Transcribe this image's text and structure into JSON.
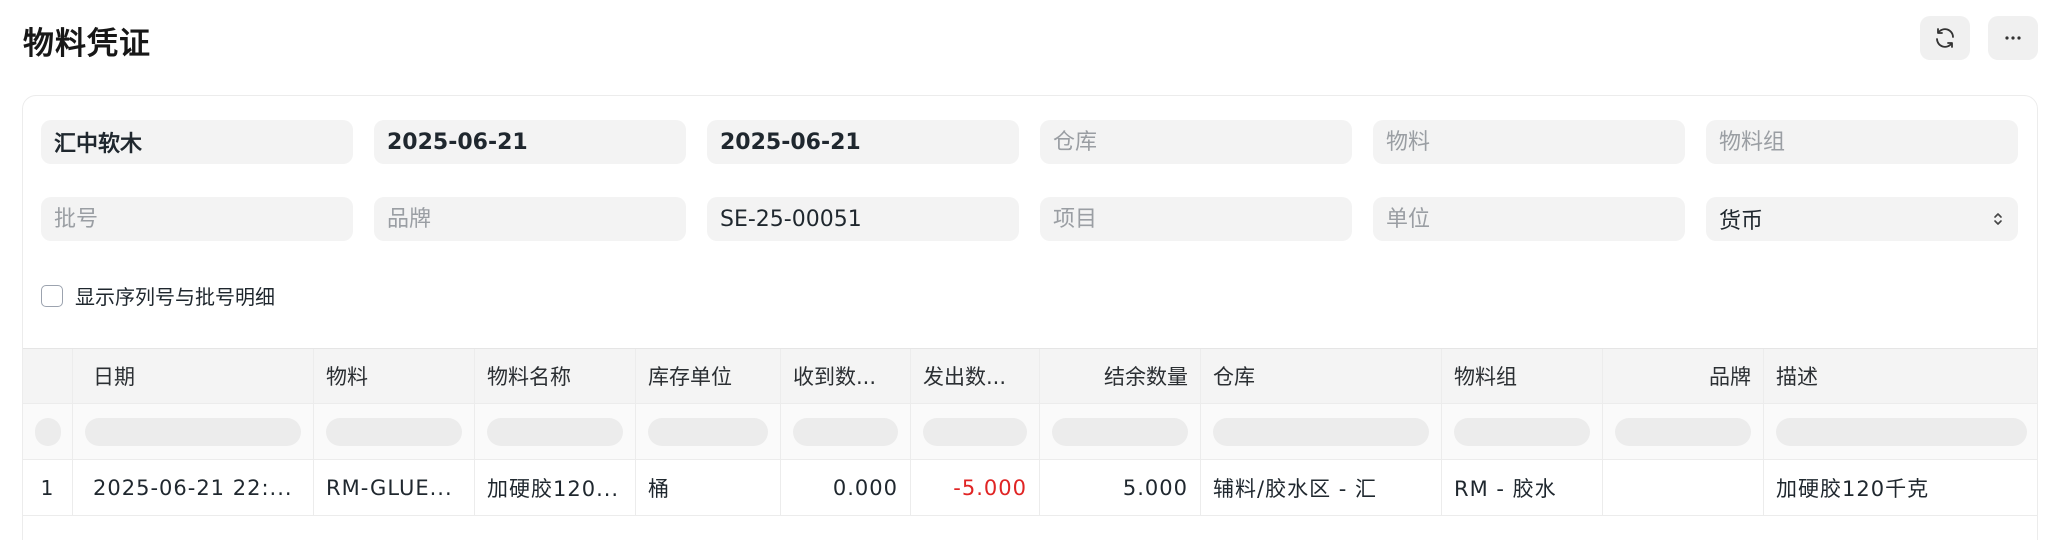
{
  "page": {
    "title": "物料凭证"
  },
  "filters": {
    "company": {
      "value": "汇中软木",
      "placeholder": ""
    },
    "from_date": {
      "value": "2025-06-21",
      "placeholder": ""
    },
    "to_date": {
      "value": "2025-06-21",
      "placeholder": ""
    },
    "warehouse": {
      "value": "",
      "placeholder": "仓库"
    },
    "item": {
      "value": "",
      "placeholder": "物料"
    },
    "item_group": {
      "value": "",
      "placeholder": "物料组"
    },
    "batch_no": {
      "value": "",
      "placeholder": "批号"
    },
    "brand": {
      "value": "",
      "placeholder": "品牌"
    },
    "voucher_no": {
      "value": "SE-25-00051",
      "placeholder": ""
    },
    "project": {
      "value": "",
      "placeholder": "项目"
    },
    "uom": {
      "value": "",
      "placeholder": "单位"
    },
    "currency": {
      "value": "货币"
    }
  },
  "options": {
    "show_serial_batch_label": "显示序列号与批号明细",
    "show_serial_batch_checked": false
  },
  "table": {
    "columns": [
      "日期",
      "物料",
      "物料名称",
      "库存单位",
      "收到数...",
      "发出数...",
      "结余数量",
      "仓库",
      "物料组",
      "品牌",
      "描述"
    ],
    "rows": [
      {
        "index": "1",
        "date": "2025-06-21 22:...",
        "item": "RM-GLUE...",
        "item_name": "加硬胶120...",
        "uom": "桶",
        "in_qty": "0.000",
        "out_qty": "-5.000",
        "balance_qty": "5.000",
        "warehouse": "辅料/胶水区 - 汇",
        "item_group": "RM - 胶水",
        "brand": "",
        "description": "加硬胶120千克"
      }
    ]
  },
  "icons": {
    "refresh": "refresh-icon",
    "more": "more-horizontal-icon",
    "select_arrows": "chevron-up-down-icon"
  },
  "colors": {
    "negative": "#e02424",
    "field_bg": "#f3f3f3",
    "header_bg": "#f4f4f4"
  }
}
